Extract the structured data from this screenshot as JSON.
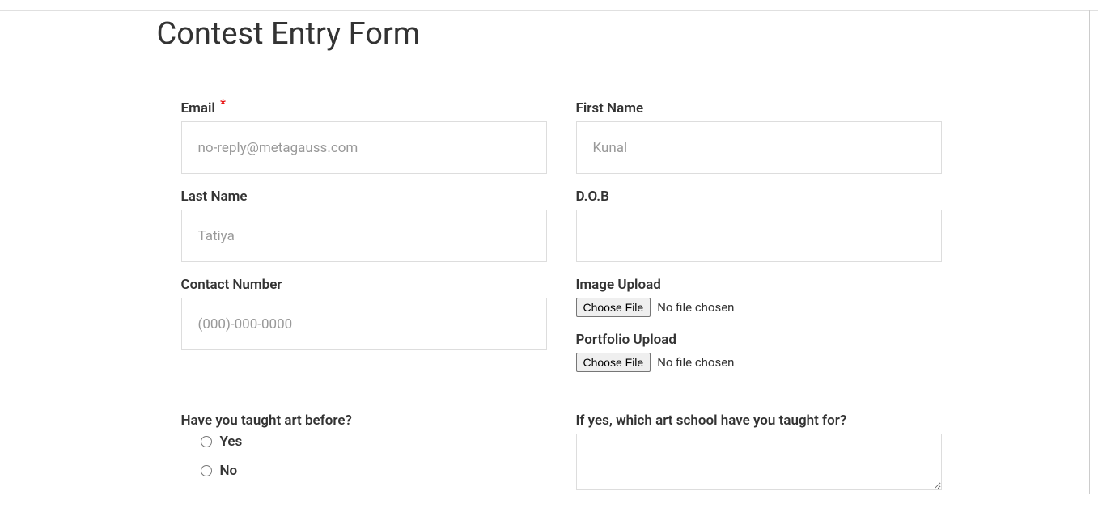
{
  "page": {
    "title": "Contest Entry Form"
  },
  "form": {
    "email": {
      "label": "Email",
      "required_mark": "*",
      "placeholder": "no-reply@metagauss.com",
      "value": ""
    },
    "first_name": {
      "label": "First Name",
      "placeholder": "Kunal",
      "value": ""
    },
    "last_name": {
      "label": "Last Name",
      "placeholder": "Tatiya",
      "value": ""
    },
    "dob": {
      "label": "D.O.B",
      "value": ""
    },
    "contact_number": {
      "label": "Contact Number",
      "placeholder": "(000)-000-0000",
      "value": ""
    },
    "image_upload": {
      "label": "Image Upload",
      "button": "Choose File",
      "status": "No file chosen"
    },
    "portfolio_upload": {
      "label": "Portfolio Upload",
      "button": "Choose File",
      "status": "No file chosen"
    },
    "taught_art": {
      "label": "Have you taught art before?",
      "options": {
        "yes": "Yes",
        "no": "No"
      }
    },
    "art_school": {
      "label": "If yes, which art school have you taught for?",
      "value": ""
    }
  }
}
